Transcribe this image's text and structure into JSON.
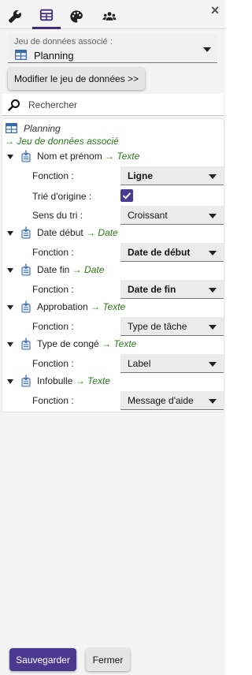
{
  "toolbar": {
    "tabs": [
      {
        "name": "wrench-icon",
        "active": false
      },
      {
        "name": "table-icon",
        "active": true
      },
      {
        "name": "palette-icon",
        "active": false
      },
      {
        "name": "users-icon",
        "active": false
      }
    ],
    "close_label": "×"
  },
  "dataset": {
    "label": "Jeu de données associé :",
    "value": "Planning",
    "modify_button": "Modifier le jeu de données >>"
  },
  "search": {
    "placeholder": "Rechercher"
  },
  "tree": {
    "root_name": "Planning",
    "root_link": "→ Jeu de données associé",
    "fields": [
      {
        "name": "Nom et prénom",
        "type": "→ Texte",
        "properties": [
          {
            "label": "Fonction :",
            "kind": "select",
            "value": "Ligne",
            "bold": true
          },
          {
            "label": "Trié d'origine :",
            "kind": "checkbox",
            "checked": true
          },
          {
            "label": "Sens du tri :",
            "kind": "select",
            "value": "Croissant",
            "bold": false
          }
        ]
      },
      {
        "name": "Date début",
        "type": "→ Date",
        "properties": [
          {
            "label": "Fonction :",
            "kind": "select",
            "value": "Date de début",
            "bold": true
          }
        ]
      },
      {
        "name": "Date fin",
        "type": "→ Date",
        "properties": [
          {
            "label": "Fonction :",
            "kind": "select",
            "value": "Date de fin",
            "bold": true
          }
        ]
      },
      {
        "name": "Approbation",
        "type": "→ Texte",
        "properties": [
          {
            "label": "Fonction :",
            "kind": "select",
            "value": "Type de tâche",
            "bold": false
          }
        ]
      },
      {
        "name": "Type de congé",
        "type": "→ Texte",
        "properties": [
          {
            "label": "Fonction :",
            "kind": "select",
            "value": "Label",
            "bold": false
          }
        ]
      },
      {
        "name": "Infobulle",
        "type": "→ Texte",
        "properties": [
          {
            "label": "Fonction :",
            "kind": "select",
            "value": "Message d'aide",
            "bold": false
          }
        ]
      }
    ]
  },
  "footer": {
    "save_label": "Sauvegarder",
    "close_label": "Fermer"
  },
  "colors": {
    "accent": "#4a3a8f",
    "type_green": "#2a7a1a",
    "panel_bg": "#f4f4f4"
  }
}
